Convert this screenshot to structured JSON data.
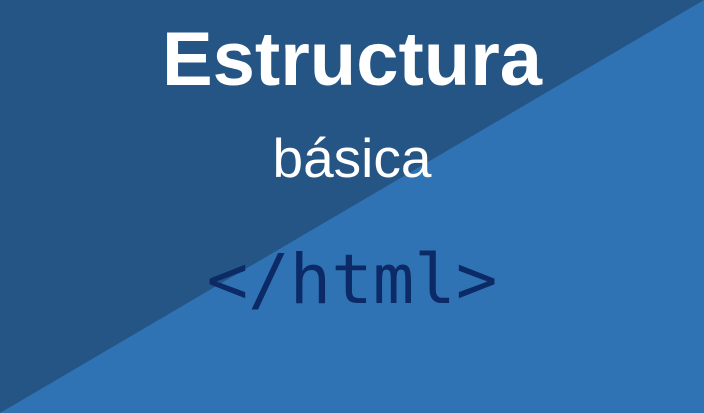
{
  "banner": {
    "title": "Estructura",
    "subtitle": "básica",
    "code_tag": "</html>"
  },
  "colors": {
    "dark_triangle": "#255585",
    "light_triangle": "#2f73b5",
    "title_text": "#ffffff",
    "code_text": "#0c2a66"
  }
}
